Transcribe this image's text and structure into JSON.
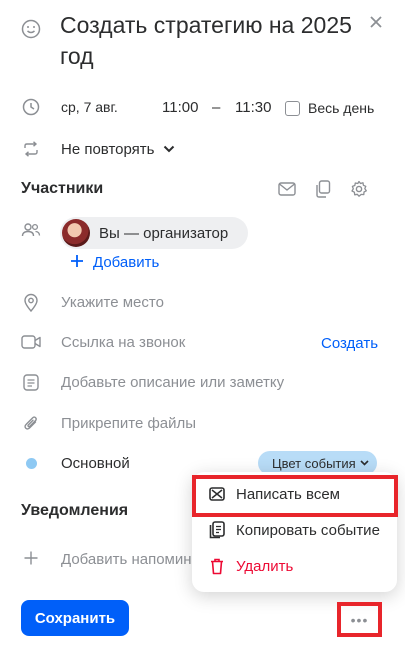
{
  "event": {
    "title": "Создать стратегию на 2025 год",
    "date": "ср, 7 авг.",
    "time_start": "11:00",
    "time_sep": "–",
    "time_end": "11:30",
    "all_day_label": "Весь день",
    "repeat_label": "Не повторять"
  },
  "participants": {
    "heading": "Участники",
    "organizer_label": "Вы — организатор",
    "add_label": "Добавить"
  },
  "fields": {
    "location_placeholder": "Укажите место",
    "call_link_label": "Ссылка на звонок",
    "call_create_label": "Создать",
    "description_placeholder": "Добавьте описание или заметку",
    "attach_label": "Прикрепите файлы",
    "calendar_name": "Основной",
    "color_button_label": "Цвет события"
  },
  "notifications": {
    "heading": "Уведомления",
    "add_label": "Добавить напомин"
  },
  "menu": {
    "items": [
      {
        "label": "Написать всем"
      },
      {
        "label": "Копировать событие"
      },
      {
        "label": "Удалить"
      }
    ]
  },
  "footer": {
    "save_label": "Сохранить",
    "more_label": "•••"
  },
  "colors": {
    "accent": "#005ff9",
    "danger": "#ed0a34",
    "highlight": "#e8252b",
    "calendar_dot": "#8ec9f3"
  }
}
